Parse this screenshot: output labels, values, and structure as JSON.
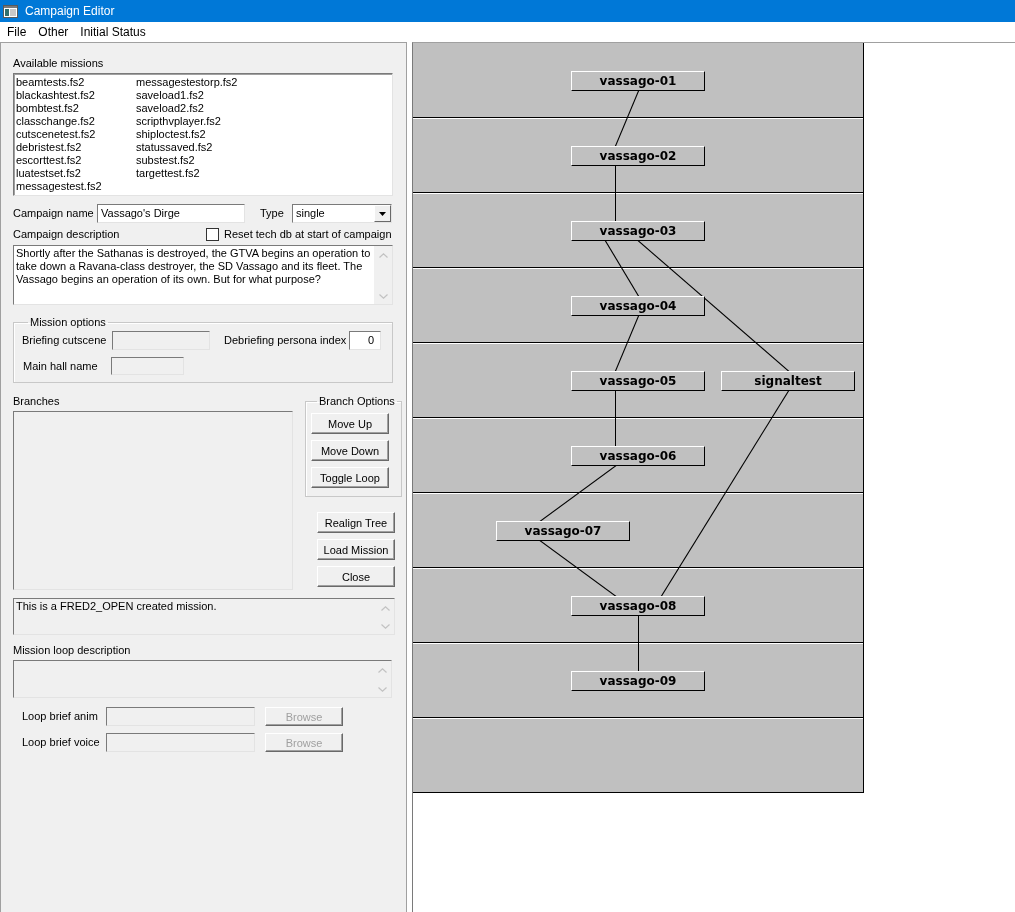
{
  "window": {
    "title": "Campaign Editor"
  },
  "menu": [
    "File",
    "Other",
    "Initial Status"
  ],
  "available_missions": {
    "label": "Available missions",
    "items": [
      {
        "name": "beamtests.fs2",
        "selected": false
      },
      {
        "name": "blackashtest.fs2",
        "selected": false
      },
      {
        "name": "bombtest.fs2",
        "selected": false
      },
      {
        "name": "classchange.fs2",
        "selected": false
      },
      {
        "name": "cutscenetest.fs2",
        "selected": false
      },
      {
        "name": "debristest.fs2",
        "selected": false
      },
      {
        "name": "escorttest.fs2",
        "selected": false
      },
      {
        "name": "luatestset.fs2",
        "selected": false
      },
      {
        "name": "messagestest.fs2",
        "selected": false
      },
      {
        "name": "messagestestorp.fs2",
        "selected": false
      },
      {
        "name": "saveload1.fs2",
        "selected": false
      },
      {
        "name": "saveload2.fs2",
        "selected": false
      },
      {
        "name": "scripthvplayer.fs2",
        "selected": false
      },
      {
        "name": "shiploctest.fs2",
        "selected": false
      },
      {
        "name": "statussaved.fs2",
        "selected": false
      },
      {
        "name": "substest.fs2",
        "selected": false
      },
      {
        "name": "targettest.fs2",
        "selected": false
      }
    ]
  },
  "campaign_name": {
    "label": "Campaign name",
    "value": "Vassago's Dirge"
  },
  "campaign_type": {
    "label": "Type",
    "value": "single"
  },
  "reset_tech_db": {
    "label": "Reset tech db at start of campaign",
    "checked": false
  },
  "campaign_description": {
    "label": "Campaign description",
    "text": "Shortly after the Sathanas is destroyed, the GTVA begins an operation to take down a Ravana-class destroyer, the SD Vassago and its fleet. The Vassago begins an operation of its own. But for what purpose?",
    "disabled": false
  },
  "mission_options": {
    "title": "Mission options",
    "briefing_cutscene": {
      "label": "Briefing cutscene",
      "disabled": true
    },
    "debriefing_persona_index": {
      "label": "Debriefing persona index",
      "value": "0",
      "disabled": false
    },
    "main_hall_name": {
      "label": "Main hall name",
      "disabled": true
    }
  },
  "branches": {
    "label": "Branches",
    "disabled": true
  },
  "branch_options": {
    "title": "Branch Options",
    "buttons": [
      "Move Up",
      "Move Down",
      "Toggle Loop"
    ]
  },
  "actions": [
    "Realign Tree",
    "Load Mission",
    "Close"
  ],
  "mission_description": {
    "text": "This is a FRED2_OPEN created mission.",
    "disabled": true
  },
  "mission_loop": {
    "label": "Mission loop description",
    "disabled": true,
    "fields": [
      {
        "label": "Loop brief anim",
        "disabled": true,
        "button": {
          "label": "Browse",
          "disabled": true
        }
      },
      {
        "label": "Loop brief voice",
        "disabled": true,
        "button": {
          "label": "Browse",
          "disabled": true
        }
      }
    ]
  },
  "campaign_tree": {
    "rows": [
      {
        "missions": [
          "vassago-01"
        ]
      },
      {
        "missions": [
          "vassago-02"
        ]
      },
      {
        "missions": [
          "vassago-03"
        ]
      },
      {
        "missions": [
          "vassago-04"
        ]
      },
      {
        "missions": [
          "vassago-05",
          "signaltest"
        ]
      },
      {
        "missions": [
          "vassago-06"
        ]
      },
      {
        "missions": [
          "vassago-07"
        ]
      },
      {
        "missions": [
          "vassago-08"
        ]
      },
      {
        "missions": [
          "vassago-09"
        ]
      }
    ]
  }
}
